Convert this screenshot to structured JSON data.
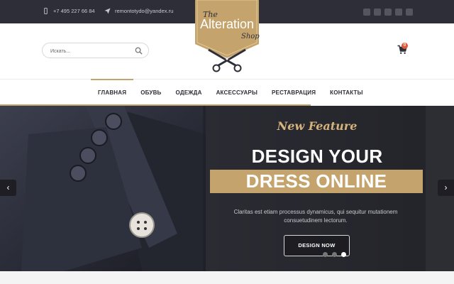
{
  "topbar": {
    "phone": "+7 495 227 66 84",
    "email": "remontotydo@yandex.ru",
    "socials": [
      "facebook-icon",
      "twitter-icon",
      "vk-icon",
      "google-plus-icon",
      "rss-icon"
    ]
  },
  "logo": {
    "word_the": "The",
    "word_main": "Alteration",
    "word_shop": "Shop"
  },
  "search": {
    "placeholder": "Искать..."
  },
  "cart": {
    "count": "0"
  },
  "nav": {
    "items": [
      "ГЛАВНАЯ",
      "ОБУВЬ",
      "ОДЕЖДА",
      "АКСЕССУАРЫ",
      "РЕСТАВРАЦИЯ",
      "КОНТАКТЫ"
    ],
    "active_index": 0
  },
  "hero": {
    "eyebrow": "New Feature",
    "headline_1": "DESIGN YOUR",
    "headline_2": "DRESS ONLINE",
    "description": "Claritas est etiam processus dynamicus, qui sequitur mutationem consuetudinem lectorum.",
    "cta": "DESIGN NOW",
    "slide_count": 3,
    "active_slide": 3,
    "prev_arrow": "‹",
    "next_arrow": "›"
  },
  "colors": {
    "accent_gold": "#c4a46c",
    "dark": "#2e2e38",
    "badge": "#e05a3a"
  }
}
